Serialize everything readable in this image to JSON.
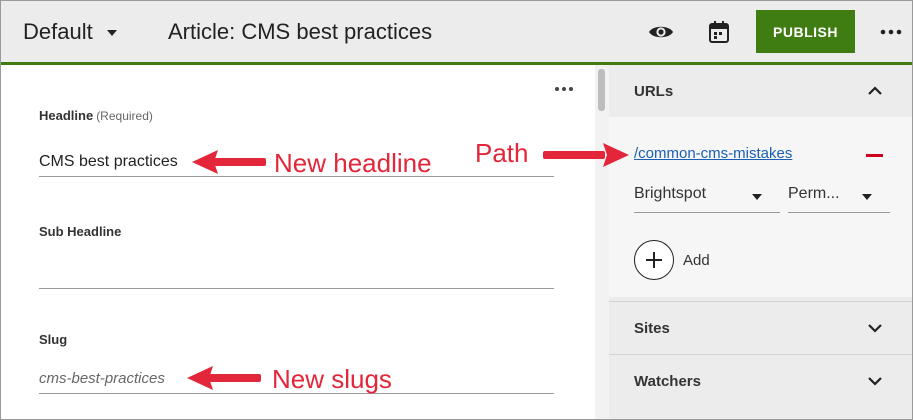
{
  "header": {
    "content_select": "Default",
    "title": "Article: CMS best practices",
    "publish_label": "PUBLISH",
    "icons": [
      "eye-icon",
      "calendar-icon",
      "more-horizontal-icon"
    ]
  },
  "form": {
    "headline_label": "Headline",
    "headline_required": "(Required)",
    "headline_value": "CMS best practices",
    "subheadline_label": "Sub Headline",
    "subheadline_value": "",
    "slug_label": "Slug",
    "slug_value": "cms-best-practices"
  },
  "sidebar": {
    "urls_title": "URLs",
    "url_path": "/common-cms-mistakes",
    "site_select": "Brightspot",
    "type_select": "Perm...",
    "add_label": "Add",
    "sites_title": "Sites",
    "watchers_title": "Watchers"
  },
  "annotations": {
    "headline": "New headline",
    "path": "Path",
    "slug": "New slugs"
  },
  "colors": {
    "accent_green": "#3f7d12",
    "link_blue": "#1a5fb4",
    "remove_red": "#d0021b",
    "annotation_red": "#e3263a",
    "header_bg": "#ececec"
  }
}
